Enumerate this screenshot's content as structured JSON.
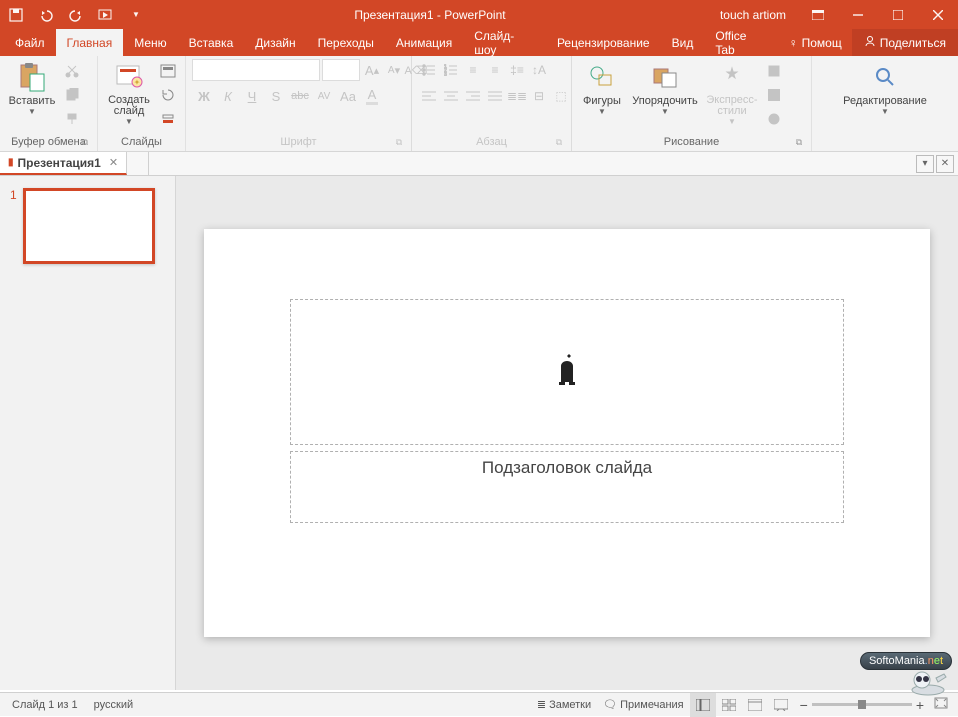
{
  "titlebar": {
    "doc_title": "Презентация1",
    "app_suffix": " - PowerPoint",
    "user": "touch artiom"
  },
  "tabs": {
    "file": "Файл",
    "home": "Главная",
    "menu": "Меню",
    "insert": "Вставка",
    "design": "Дизайн",
    "transitions": "Переходы",
    "animation": "Анимация",
    "slideshow": "Слайд-шоу",
    "review": "Рецензирование",
    "view": "Вид",
    "officetab": "Office Tab",
    "help": "Помощ",
    "share": "Поделиться"
  },
  "ribbon": {
    "clipboard": {
      "label": "Буфер обмена",
      "paste": "Вставить"
    },
    "slides": {
      "label": "Слайды",
      "new_slide": "Создать слайд"
    },
    "font": {
      "label": "Шрифт",
      "b": "Ж",
      "i": "К",
      "u": "Ч",
      "s": "S",
      "abc": "abc",
      "av": "AV",
      "aa": "Aa",
      "a_big": "A",
      "grow": "A",
      "shrink": "A"
    },
    "paragraph": {
      "label": "Абзац"
    },
    "drawing": {
      "label": "Рисование",
      "shapes": "Фигуры",
      "arrange": "Упорядочить",
      "quick_styles": "Экспресс-стили"
    },
    "editing": {
      "label": "Редактирование"
    }
  },
  "doctab": {
    "name": "Презентация1"
  },
  "slide": {
    "number": "1",
    "subtitle_placeholder": "Подзаголовок слайда"
  },
  "statusbar": {
    "slide_pos": "Слайд 1 из 1",
    "language": "русский",
    "notes": "Заметки",
    "comments": "Примечания"
  },
  "watermark": {
    "text": "SoftoMania"
  }
}
